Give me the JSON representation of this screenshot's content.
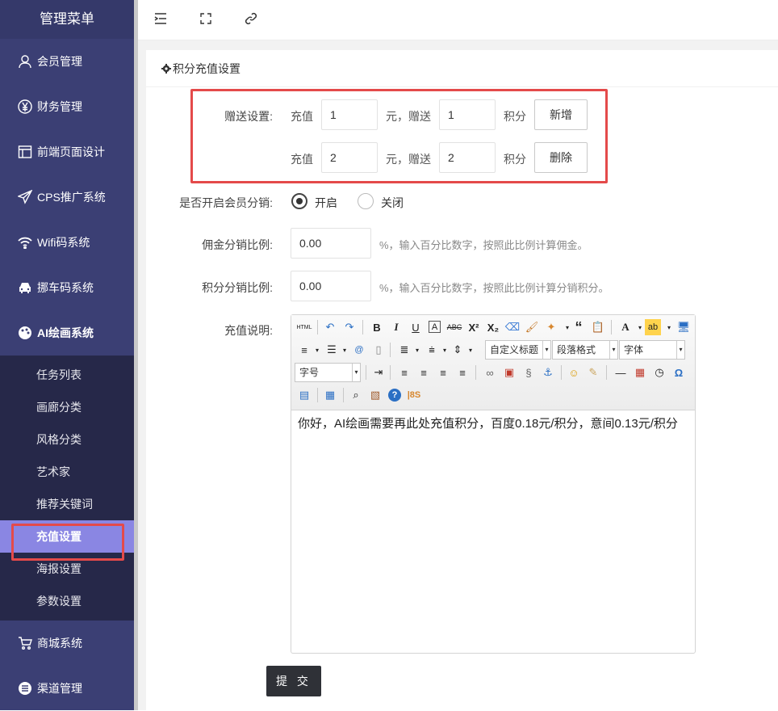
{
  "sidebar": {
    "title": "管理菜单",
    "items": [
      {
        "label": "会员管理",
        "icon": "user-icon"
      },
      {
        "label": "财务管理",
        "icon": "yen-icon"
      },
      {
        "label": "前端页面设计",
        "icon": "layout-icon"
      },
      {
        "label": "CPS推广系统",
        "icon": "send-icon"
      },
      {
        "label": "Wifi码系统",
        "icon": "wifi-icon"
      },
      {
        "label": "挪车码系统",
        "icon": "car-icon"
      },
      {
        "label": "AI绘画系统",
        "icon": "palette-icon"
      }
    ],
    "sub_items": [
      "任务列表",
      "画廊分类",
      "风格分类",
      "艺术家",
      "推荐关键词",
      "充值设置",
      "海报设置",
      "参数设置"
    ],
    "bottom_items": [
      {
        "label": "商城系统",
        "icon": "cart-icon"
      },
      {
        "label": "渠道管理",
        "icon": "menu-circle-icon"
      }
    ]
  },
  "card": {
    "title": "积分充值设置"
  },
  "gift": {
    "label": "赠送设置:",
    "rows": [
      {
        "recharge_label": "充值",
        "recharge_value": "1",
        "mid_text": "元，赠送",
        "gift_value": "1",
        "unit": "积分",
        "button": "新增"
      },
      {
        "recharge_label": "充值",
        "recharge_value": "2",
        "mid_text": "元，赠送",
        "gift_value": "2",
        "unit": "积分",
        "button": "删除"
      }
    ]
  },
  "distribution": {
    "label": "是否开启会员分销:",
    "options": [
      "开启",
      "关闭"
    ],
    "selected": "开启"
  },
  "commission": {
    "label": "佣金分销比例:",
    "value": "0.00",
    "hint": "%，输入百分比数字，按照此比例计算佣金。"
  },
  "points_ratio": {
    "label": "积分分销比例:",
    "value": "0.00",
    "hint": "%，输入百分比数字，按照此比例计算分销积分。"
  },
  "description": {
    "label": "充值说明:",
    "content": "你好，AI绘画需要再此处充值积分，百度0.18元/积分，意间0.13元/积分",
    "toolbar": {
      "html": "HTML",
      "custom_title": "自定义标题",
      "paragraph": "段落格式",
      "font": "字体",
      "size": "字号"
    }
  },
  "submit_label": "提 交",
  "colors": {
    "sidebar": "#3b3f74",
    "active": "#8a86e3",
    "highlight_border": "#e44a4a"
  }
}
